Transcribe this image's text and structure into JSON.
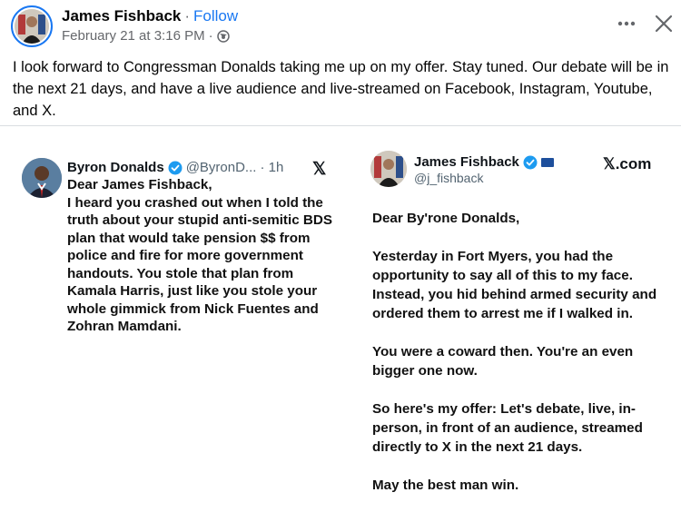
{
  "post": {
    "author": "James Fishback",
    "dot": "·",
    "follow_label": "Follow",
    "timestamp": "February 21 at 3:16 PM",
    "meta_sep": "·",
    "privacy_icon": "globe-icon",
    "more_icon": "more-horizontal-icon",
    "close_icon": "close-icon",
    "text": "I look forward to Congressman Donalds taking me up on my offer. Stay tuned. Our debate will be in the next 21 days, and have a live audience and live-streamed on Facebook, Instagram, Youtube, and X."
  },
  "left_tweet": {
    "name": "Byron Donalds",
    "verified_icon": "verified-badge-icon",
    "handle": "@ByronD...",
    "age": "· 1h",
    "platform_icon": "x-logo-icon",
    "platform": "𝕏",
    "body": "Dear James Fishback,\nI heard you crashed out when I told the truth about your stupid anti-semitic BDS plan that would take pension $$ from police and fire for more government handouts. You stole that plan from Kamala Harris, just like you stole your whole gimmick from Nick Fuentes and Zohran Mamdani."
  },
  "right_tweet": {
    "name": "James Fishback",
    "verified_icon": "verified-badge-icon",
    "flag_icon": "flag-icon",
    "handle": "@j_fishback",
    "platform": "𝕏.com",
    "paragraphs": [
      "Dear By'rone Donalds,",
      "Yesterday in Fort Myers, you had the opportunity to say all of this to my face. Instead, you hid behind armed security and ordered them to arrest me if I walked in.",
      "You were a coward then. You're an even bigger one now.",
      "So here's my offer: Let's debate, live, in-person, in front of an audience, streamed directly to X in the next 21 days.",
      "May the best man win."
    ]
  },
  "colors": {
    "accent": "#1877f2",
    "secondary_text": "#65676b",
    "verified": "#1d9bf0"
  }
}
